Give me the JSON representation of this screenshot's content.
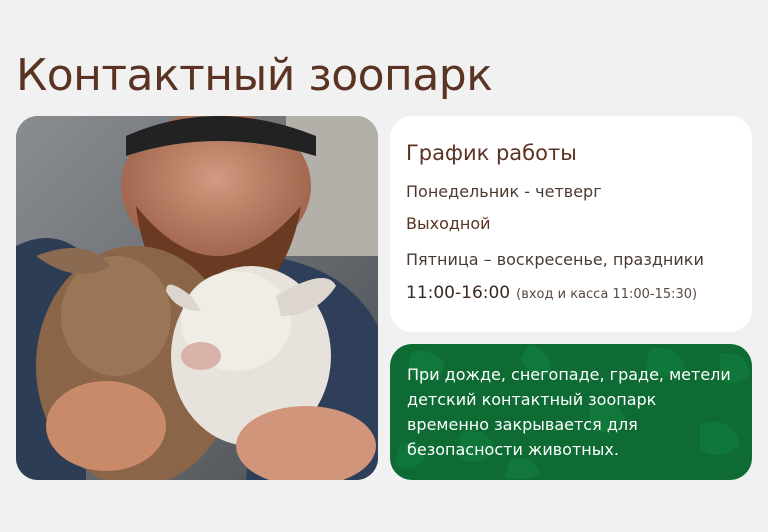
{
  "page": {
    "title": "Контактный зоопарк"
  },
  "photo": {
    "description_icon": "goat-kids-photo"
  },
  "schedule": {
    "title": "График работы",
    "rows": [
      {
        "days": "Понедельник - четверг",
        "status": "Выходной"
      },
      {
        "days": "Пятница – воскресенье, праздники",
        "hours": "11:00-16:00",
        "note": "(вход и касса 11:00-15:30)"
      }
    ]
  },
  "notice": {
    "text": "При дожде, снегопаде, граде, метели детский контактный зоопарк временно закрывается для безопасности животных."
  },
  "colors": {
    "title": "#5a3322",
    "background": "#f1f1f1",
    "notice_bg": "#0d6b33",
    "card_bg": "#ffffff"
  }
}
